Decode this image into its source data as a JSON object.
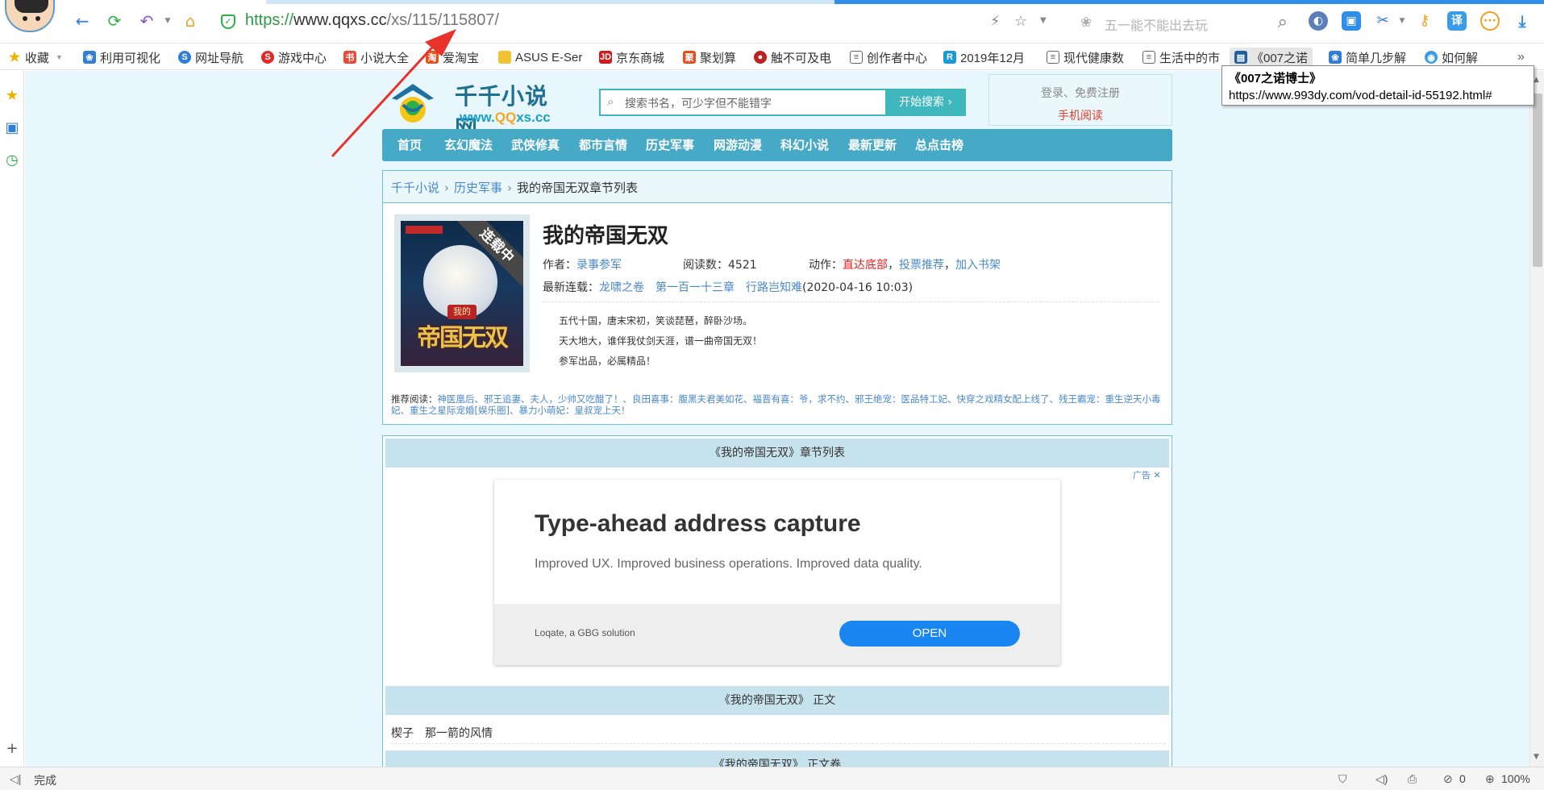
{
  "browser": {
    "url_proto": "https://",
    "url_host": "www.qqxs.cc",
    "url_path": "/xs/115/115807/",
    "search_placeholder": "五一能不能出去玩"
  },
  "bookmarks": [
    {
      "label": "收藏",
      "icon": "star-icon"
    },
    {
      "label": "利用可视化",
      "icon": "paw-icon"
    },
    {
      "label": "网址导航",
      "icon": "globe-icon"
    },
    {
      "label": "游戏中心",
      "icon": "game-icon"
    },
    {
      "label": "小说大全",
      "icon": "book-icon"
    },
    {
      "label": "爱淘宝",
      "icon": "taobao-icon"
    },
    {
      "label": "ASUS E-Ser",
      "icon": "folder-icon"
    },
    {
      "label": "京东商城",
      "icon": "jd-icon"
    },
    {
      "label": "聚划算",
      "icon": "juhuasuan-icon"
    },
    {
      "label": "触不可及电",
      "icon": "film-icon"
    },
    {
      "label": "创作者中心",
      "icon": "page-icon"
    },
    {
      "label": "2019年12月",
      "icon": "doc-icon"
    },
    {
      "label": "现代健康数",
      "icon": "page-icon"
    },
    {
      "label": "生活中的市",
      "icon": "page-icon"
    },
    {
      "label": "《007之诺",
      "icon": "film-icon"
    },
    {
      "label": "简单几步解",
      "icon": "paw-icon"
    },
    {
      "label": "如何解",
      "icon": "globe-icon"
    }
  ],
  "tooltip": {
    "title": "《007之诺博士》",
    "url": "https://www.993dy.com/vod-detail-id-55192.html#"
  },
  "site": {
    "logo_cn": "千千小说网",
    "logo_en_prefix": "www.",
    "logo_en_mid": "QQ",
    "logo_en_suffix": "xs.cc",
    "search_placeholder": "搜索书名，可少字但不能错字",
    "search_button": "开始搜索 ›",
    "login_text": "登录、免费注册",
    "mobile_read": "手机阅读",
    "nav": [
      "首页",
      "玄幻魔法",
      "武侠修真",
      "都市言情",
      "历史军事",
      "网游动漫",
      "科幻小说",
      "最新更新",
      "总点击榜"
    ]
  },
  "breadcrumb": {
    "root": "千千小说",
    "category": "历史军事",
    "current": "我的帝国无双章节列表"
  },
  "book": {
    "status_ribbon": "连载中",
    "cover_title": "帝国无双",
    "cover_seal": "我的",
    "title": "我的帝国无双",
    "author_label": "作者：",
    "author": "录事参军",
    "reads_label": "阅读数：",
    "reads": "4521",
    "actions_label": "动作：",
    "action_bottom": "直达底部",
    "action_vote": "投票推荐",
    "action_shelf": "加入书架",
    "latest_label": "最新连载：",
    "latest_chapter": "龙啸之卷　第一百一十三章　行路岂知难",
    "latest_time": "(2020-04-16 10:03)",
    "intro": [
      "五代十国，唐末宋初，笑谈琵琶，醉卧沙场。",
      "天大地大，谁伴我仗剑天涯，谱一曲帝国无双！",
      "参军出品，必属精品！"
    ],
    "recommend_label": "推荐阅读：",
    "recommend_text": "神医凰后、邪王追妻、夫人，少帅又吃醋了！、良田喜事：腹黑夫君美如花、福晋有喜：爷，求不约、邪王绝宠：医品特工妃、快穿之戏精女配上线了、残王霸宠：重生逆天小毒妃、重生之星际宠婚[娱乐圈]、暴力小萌妃：皇叔宠上天！"
  },
  "chapters": {
    "list_header": "《我的帝国无双》章节列表",
    "body_header": "《我的帝国无双》 正文",
    "first_chapter": "楔子　那一箭的风情",
    "next_header": "《我的帝国无双》 正文卷"
  },
  "ad": {
    "label": "广告 ✕",
    "title": "Type-ahead address capture",
    "subtitle": "Improved UX. Improved business operations. Improved data quality.",
    "brand": "Loqate, a GBG solution",
    "button": "OPEN"
  },
  "status": {
    "done": "完成",
    "count": "0",
    "zoom": "100%"
  }
}
